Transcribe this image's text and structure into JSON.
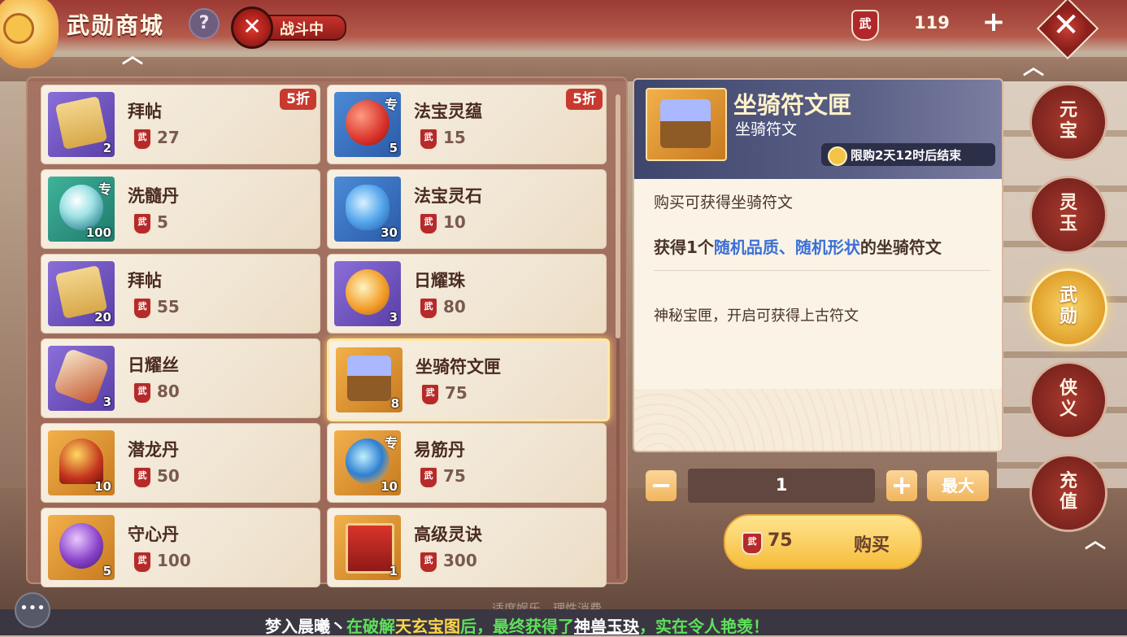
{
  "header": {
    "title": "武勋商城",
    "help_label": "?",
    "battle_status": "战斗中",
    "currency_icon_text": "武",
    "currency_amount": "119",
    "plus_label": "+",
    "close_label": "✕"
  },
  "items": [
    {
      "name": "拜帖",
      "price": "27",
      "qty": "2",
      "discount": "5折",
      "exclusive": "",
      "color": "purple",
      "art": "scroll"
    },
    {
      "name": "法宝灵蕴",
      "price": "15",
      "qty": "5",
      "discount": "5折",
      "exclusive": "专",
      "color": "blue",
      "art": "orb-red"
    },
    {
      "name": "洗髓丹",
      "price": "5",
      "qty": "100",
      "discount": "",
      "exclusive": "专",
      "color": "green",
      "art": "orb-jade"
    },
    {
      "name": "法宝灵石",
      "price": "10",
      "qty": "30",
      "discount": "",
      "exclusive": "",
      "color": "blue",
      "art": "orb-blue"
    },
    {
      "name": "拜帖",
      "price": "55",
      "qty": "20",
      "discount": "",
      "exclusive": "",
      "color": "purple",
      "art": "scroll"
    },
    {
      "name": "日耀珠",
      "price": "80",
      "qty": "3",
      "discount": "",
      "exclusive": "",
      "color": "purple",
      "art": "orb-gold"
    },
    {
      "name": "日耀丝",
      "price": "80",
      "qty": "3",
      "discount": "",
      "exclusive": "",
      "color": "purple",
      "art": "silk"
    },
    {
      "name": "坐骑符文匣",
      "price": "75",
      "qty": "8",
      "discount": "",
      "exclusive": "",
      "color": "orange",
      "art": "box",
      "selected": true
    },
    {
      "name": "潜龙丹",
      "price": "50",
      "qty": "10",
      "discount": "",
      "exclusive": "",
      "color": "orange",
      "art": "pot"
    },
    {
      "name": "易筋丹",
      "price": "75",
      "qty": "10",
      "discount": "",
      "exclusive": "专",
      "color": "orange",
      "art": "orb-swirl"
    },
    {
      "name": "守心丹",
      "price": "100",
      "qty": "5",
      "discount": "",
      "exclusive": "",
      "color": "orange",
      "art": "orb-purple"
    },
    {
      "name": "高级灵诀",
      "price": "300",
      "qty": "1",
      "discount": "",
      "exclusive": "",
      "color": "orange",
      "art": "book"
    }
  ],
  "detail": {
    "title": "坐骑符文匣",
    "subtitle": "坐骑符文",
    "limit_text": "限购2天12时后结束",
    "desc1": "购买可获得坐骑符文",
    "desc2_prefix": "获得1个",
    "desc2_highlight": "随机品质、随机形状",
    "desc2_suffix": "的坐骑符文",
    "desc3": "神秘宝匣，开启可获得上古符文"
  },
  "purchase": {
    "minus_label": "−",
    "quantity": "1",
    "plus_label": "+",
    "max_label": "最大",
    "price": "75",
    "buy_label": "购买"
  },
  "tabs": [
    {
      "label": "元宝",
      "active": false
    },
    {
      "label": "灵玉",
      "active": false
    },
    {
      "label": "武勋",
      "active": true
    },
    {
      "label": "侠义",
      "active": false
    },
    {
      "label": "充值",
      "active": false
    }
  ],
  "bottom": {
    "notice_faint": "适度娱乐，理性消费",
    "marquee_part1": "梦入晨曦丶",
    "marquee_part2": "在破解",
    "marquee_part3": "天玄宝图",
    "marquee_part4": "后，最终获得了",
    "marquee_part5": "神兽玉玦",
    "marquee_part6": "，实在令人艳羡！"
  }
}
